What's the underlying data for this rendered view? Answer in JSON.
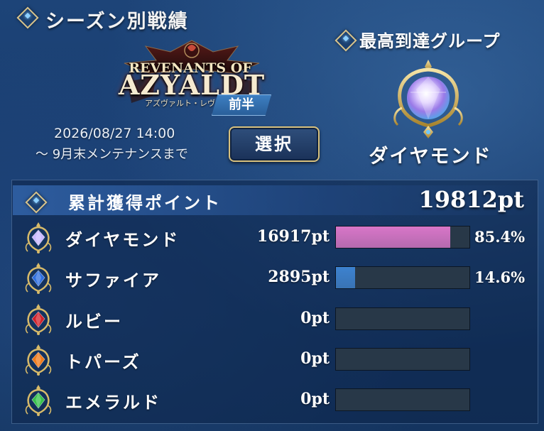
{
  "header": {
    "title": "シーズン別戦績",
    "logo": {
      "line1": "REVENANTS OF",
      "line2": "AZYALDT",
      "line3": "アズヴァルト・レヴナント"
    },
    "half_label": "前半",
    "date": "2026/08/27 14:00",
    "until": "～ 9月末メンテナンスまで",
    "select_label": "選択"
  },
  "highest": {
    "label": "最高到達グループ",
    "name": "ダイヤモンド"
  },
  "points": {
    "label": "累計獲得ポイント",
    "total": "19812pt",
    "rows": [
      {
        "name": "ダイヤモンド",
        "pts": "16917pt",
        "percent": "85.4%",
        "fraction": 0.854,
        "bar_color": "#d876c8",
        "icon": "diamond-gem-icon",
        "gem_color": "#c9b8ff"
      },
      {
        "name": "サファイア",
        "pts": "2895pt",
        "percent": "14.6%",
        "fraction": 0.146,
        "bar_color": "#3d82cf",
        "icon": "sapphire-gem-icon",
        "gem_color": "#2f6fe0"
      },
      {
        "name": "ルビー",
        "pts": "0pt",
        "percent": "",
        "fraction": 0,
        "bar_color": "#c0392b",
        "icon": "ruby-gem-icon",
        "gem_color": "#d0202a"
      },
      {
        "name": "トパーズ",
        "pts": "0pt",
        "percent": "",
        "fraction": 0,
        "bar_color": "#e08a20",
        "icon": "topaz-gem-icon",
        "gem_color": "#f07a1a"
      },
      {
        "name": "エメラルド",
        "pts": "0pt",
        "percent": "",
        "fraction": 0,
        "bar_color": "#2fae4a",
        "icon": "emerald-gem-icon",
        "gem_color": "#35c24a"
      }
    ]
  }
}
